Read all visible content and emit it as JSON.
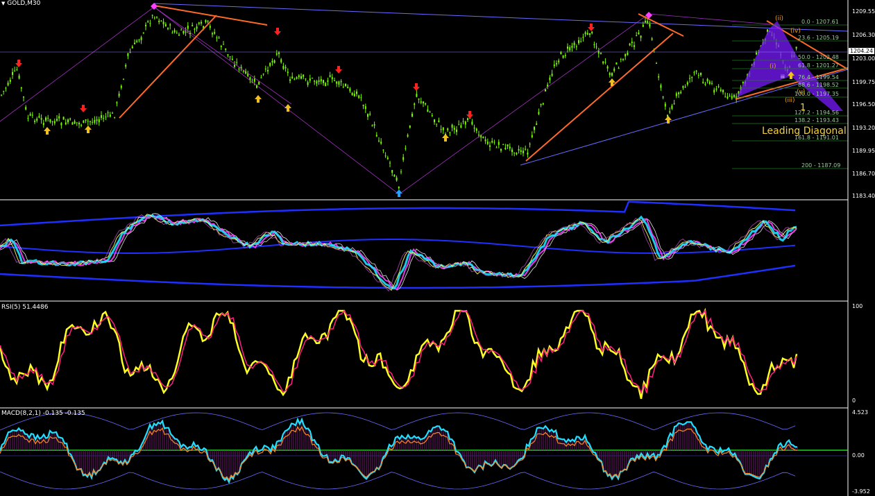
{
  "window": {
    "title": "GOLD,M30",
    "menu_icon": "triangle-down-icon"
  },
  "colors": {
    "background": "#000000",
    "grid_separator": "#ffffff",
    "candle": "#7cfc00",
    "down_arrow": "#ff2020",
    "up_arrow": "#f0c020",
    "trendline": "#ff6a2a",
    "channel": "#6a6aff",
    "envelope": "#1e2fff",
    "rsi_main": "#ffff20",
    "macd_main": "#20e0ff",
    "macd_hist": "#6a1a6a",
    "zero_line": "#20ff20"
  },
  "main_panel": {
    "price_axis": [
      "1209.55",
      "1206.30",
      "1203.00",
      "1199.75",
      "1196.50",
      "1193.20",
      "1189.95",
      "1186.70",
      "1183.40"
    ],
    "current_price": "1204.24",
    "fib_levels": [
      "0.0 - 1207.61",
      "23.6 - 1205.19",
      "50.0 - 1202.48",
      "61.8 - 1201.27",
      "76.4 - 1199.54",
      "88.6 - 1198.52",
      "100.0 - 1197.35",
      "127.2 - 1194.56",
      "138.2 - 1193.43",
      "161.8 - 1191.01",
      "200 - 1187.09"
    ],
    "wave_labels": [
      "(ii)",
      "(iv)",
      "(i)",
      "(iii)",
      "(v)",
      "iii",
      "1"
    ],
    "pattern_label": "Leading Diagonal"
  },
  "indicator_panel_1": {
    "label": ""
  },
  "rsi_panel": {
    "label": "RSI(5) 51.4486",
    "axis": [
      "100",
      "0"
    ]
  },
  "macd_panel": {
    "label": "MACD(8,2,1) -0.135 -0.135",
    "axis": [
      "4.523",
      "0.00",
      "-3.952"
    ]
  }
}
